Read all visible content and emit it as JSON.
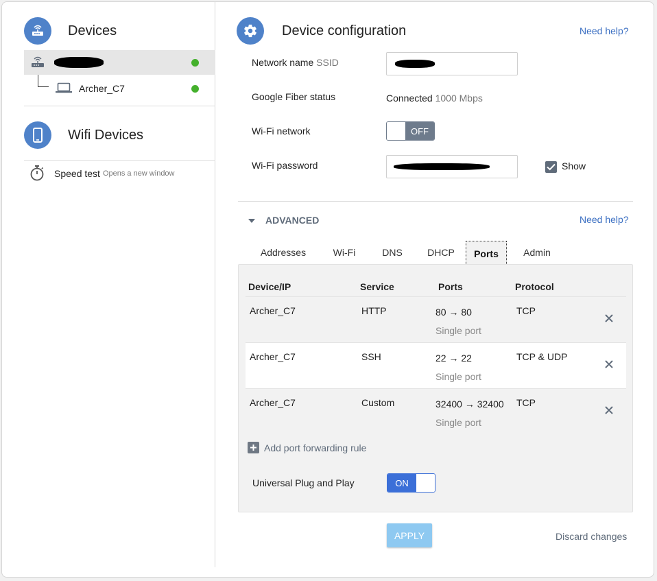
{
  "sidebar": {
    "devices_title": "Devices",
    "devices": [
      {
        "name": "",
        "status": "online",
        "icon": "router-icon",
        "redacted": true
      },
      {
        "name": "Archer_C7",
        "status": "online",
        "icon": "laptop-icon"
      }
    ],
    "wifi_devices_title": "Wifi Devices",
    "speed_test": {
      "label": "Speed test",
      "hint": "Opens a new window"
    }
  },
  "config": {
    "title": "Device configuration",
    "need_help": "Need help?",
    "ssid_label": "Network name",
    "ssid_label_suffix": "SSID",
    "fiber_status_label": "Google Fiber status",
    "fiber_status_value": "Connected",
    "fiber_status_speed": "1000 Mbps",
    "wifi_network_label": "Wi-Fi network",
    "wifi_network_toggle": "OFF",
    "wifi_password_label": "Wi-Fi password",
    "show_label": "Show",
    "show_checked": true
  },
  "advanced": {
    "title": "ADVANCED",
    "need_help": "Need help?",
    "tabs": [
      "Addresses",
      "Wi-Fi",
      "DNS",
      "DHCP",
      "Ports",
      "Admin"
    ],
    "active_tab": "Ports",
    "columns": [
      "Device/IP",
      "Service",
      "Ports",
      "Protocol"
    ],
    "rules": [
      {
        "device": "Archer_C7",
        "service": "HTTP",
        "ports": "80 → 80",
        "port_type": "Single port",
        "protocol": "TCP"
      },
      {
        "device": "Archer_C7",
        "service": "SSH",
        "ports": "22 → 22",
        "port_type": "Single port",
        "protocol": "TCP & UDP"
      },
      {
        "device": "Archer_C7",
        "service": "Custom",
        "ports": "32400 → 32400",
        "port_type": "Single port",
        "protocol": "TCP"
      }
    ],
    "add_rule_label": "Add port forwarding rule",
    "upnp_label": "Universal Plug and Play",
    "upnp_toggle": "ON"
  },
  "actions": {
    "apply": "APPLY",
    "discard": "Discard changes"
  },
  "colors": {
    "accent": "#4f82c9",
    "link": "#3b6fc2",
    "online": "#44b02c",
    "apply_disabled": "#8ec9f1",
    "toggle_on": "#3b6fd8",
    "toggle_off": "#6e7b8c"
  }
}
